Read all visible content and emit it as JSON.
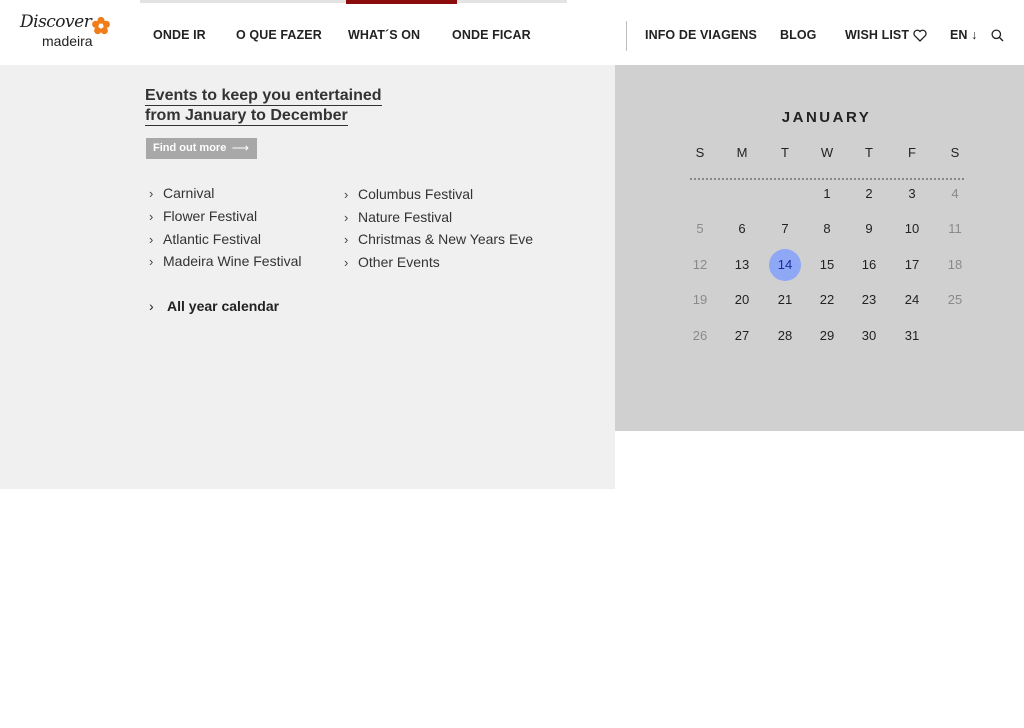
{
  "logo": {
    "line1": "Discover",
    "line2": "madeira"
  },
  "nav": {
    "onde_ir": "ONDE IR",
    "o_que_fazer": "O QUE FAZER",
    "whats_on": "WHAT´S ON",
    "onde_ficar": "ONDE FICAR",
    "info_viagens": "INFO DE VIAGENS",
    "blog": "BLOG",
    "wish_list": "WISH LIST",
    "language": "EN ↓"
  },
  "events": {
    "headline_line1": "Events to keep you entertained",
    "headline_line2": "from January to December",
    "find_out_more": "Find out more",
    "links": [
      "Carnival",
      "Flower Festival",
      "Atlantic Festival",
      "Madeira Wine Festival",
      "Columbus Festival",
      "Nature Festival",
      "Christmas & New Years Eve",
      "Other Events"
    ],
    "all_year": "All year calendar"
  },
  "calendar": {
    "month": "JANUARY",
    "weekdays": [
      "S",
      "M",
      "T",
      "W",
      "T",
      "F",
      "S"
    ],
    "days": [
      "1",
      "2",
      "3",
      "4",
      "5",
      "6",
      "7",
      "8",
      "9",
      "10",
      "11",
      "12",
      "13",
      "14",
      "15",
      "16",
      "17",
      "18",
      "19",
      "20",
      "21",
      "22",
      "23",
      "24",
      "25",
      "26",
      "27",
      "28",
      "29",
      "30",
      "31"
    ],
    "today": "14"
  },
  "colors": {
    "accent": "#8b0c0c",
    "today_highlight": "#8fa8f5"
  }
}
